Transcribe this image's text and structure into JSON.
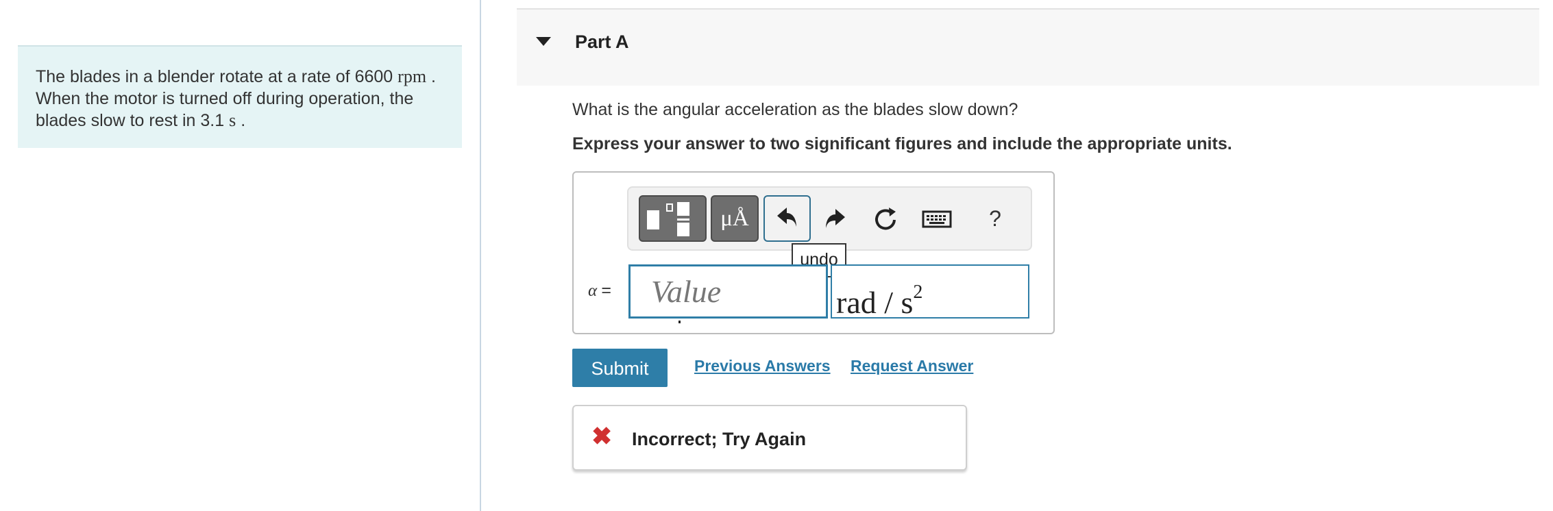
{
  "problem": {
    "text_before": "The blades in a blender rotate at a rate of 6600",
    "unit_rpm": "rpm",
    "text_middle": ". When the motor is turned off during operation, the blades slow to rest in 3.1",
    "unit_s": "s",
    "text_after": "."
  },
  "part": {
    "title": "Part A"
  },
  "question": "What is the angular acceleration as the blades slow down?",
  "instruction": "Express your answer to two significant figures and include the appropriate units.",
  "toolbar": {
    "template_icon": "fraction-template-icon",
    "units_label": "μÅ",
    "undo_icon": "undo-arrow-icon",
    "redo_icon": "redo-arrow-icon",
    "reset_icon": "reset-icon",
    "keyboard_icon": "keyboard-icon",
    "help_label": "?"
  },
  "tooltip": {
    "text": "undo"
  },
  "answer": {
    "variable": "α",
    "equals": "=",
    "value_placeholder": "Value",
    "value": "",
    "units_base": "rad / s",
    "units_exp": "2"
  },
  "actions": {
    "submit_label": "Submit",
    "previous_answers": "Previous Answers",
    "request_answer": "Request Answer"
  },
  "feedback": {
    "icon": "x-icon",
    "text": "Incorrect; Try Again",
    "icon_color": "#d03030"
  },
  "colors": {
    "accent": "#2e7ea8",
    "problem_bg": "#e5f4f5",
    "header_bg": "#f7f7f7"
  }
}
